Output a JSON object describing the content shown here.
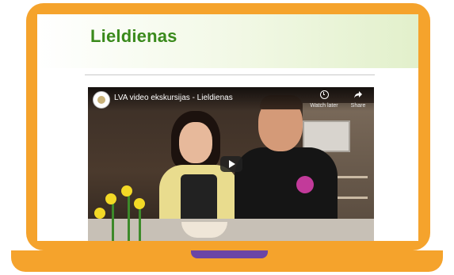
{
  "page": {
    "title": "Lieldienas"
  },
  "video": {
    "title": "LVA video ekskursijas - Lieldienas",
    "watch_later_label": "Watch later",
    "share_label": "Share"
  },
  "colors": {
    "laptop_frame": "#f5a32c",
    "notch": "#6b45a6",
    "title_green": "#3a8a1c"
  },
  "icons": {
    "watch_later": "clock-icon",
    "share": "share-arrow-icon",
    "play": "play-icon"
  }
}
